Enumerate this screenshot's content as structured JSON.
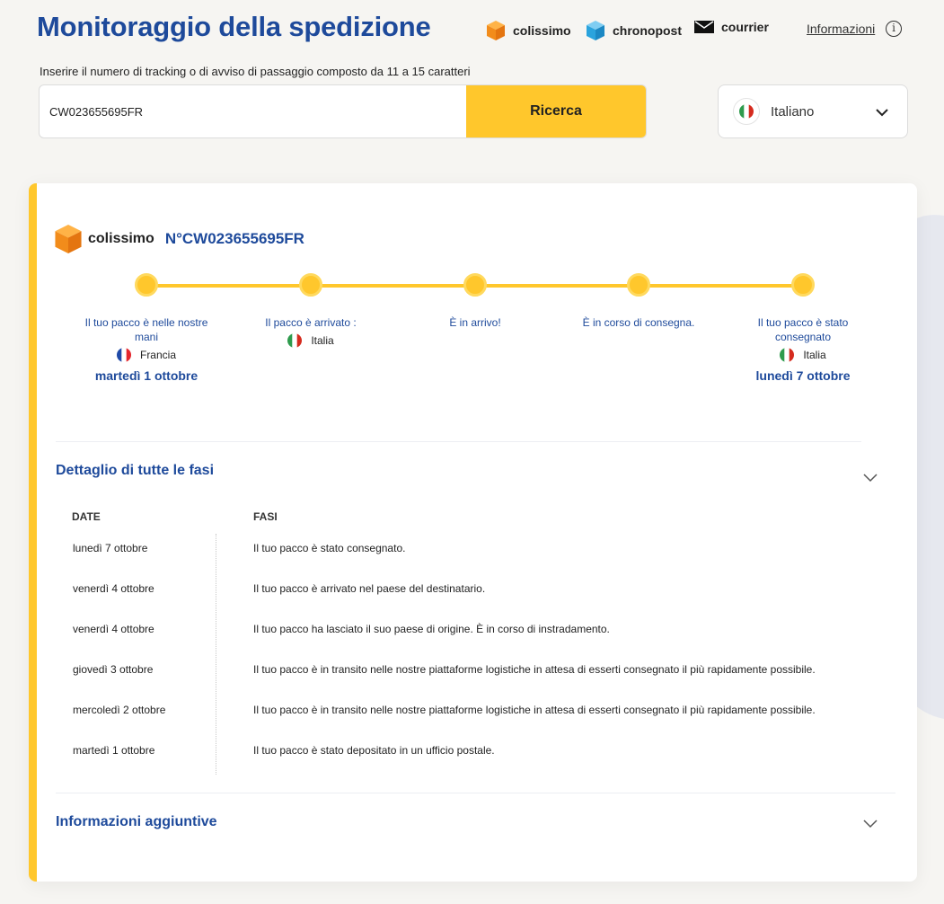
{
  "header": {
    "title": "Monitoraggio della spedizione",
    "brands": [
      "colissimo",
      "chronopost",
      "courrier"
    ],
    "info_link": "Informazioni",
    "info_icon": "i"
  },
  "search": {
    "hint": "Inserire il numero di tracking o di avviso di passaggio composto da 11 a 15 caratteri",
    "value": "CW023655695FR",
    "button": "Ricerca"
  },
  "language": {
    "label": "Italiano",
    "flag": "italy-flag-icon"
  },
  "card": {
    "brand": "colissimo",
    "tracking": "N°CW023655695FR",
    "steps": [
      {
        "label": "Il tuo pacco è nelle nostre mani",
        "country": "Francia",
        "date": "martedì 1 ottobre"
      },
      {
        "label": "Il pacco è arrivato :",
        "country": "Italia",
        "date": ""
      },
      {
        "label": "È in arrivo!",
        "country": "",
        "date": ""
      },
      {
        "label": "È in corso di consegna.",
        "country": "",
        "date": ""
      },
      {
        "label": "Il tuo pacco è stato consegnato",
        "country": "Italia",
        "date": "lunedì 7 ottobre"
      }
    ],
    "details_title": "Dettaglio di tutte le fasi",
    "table": {
      "col_date": "DATE",
      "col_phase": "FASI",
      "rows": [
        {
          "date": "lunedì 7 ottobre",
          "phase": "Il tuo pacco è stato consegnato."
        },
        {
          "date": "venerdì 4 ottobre",
          "phase": "Il tuo pacco è arrivato nel paese del destinatario."
        },
        {
          "date": "venerdì 4 ottobre",
          "phase": "Il tuo pacco ha lasciato il suo paese di origine. È in corso di instradamento."
        },
        {
          "date": "giovedì 3 ottobre",
          "phase": "Il tuo pacco è in transito nelle nostre piattaforme logistiche in attesa di esserti consegnato il più rapidamente possibile."
        },
        {
          "date": "mercoledì 2 ottobre",
          "phase": "Il tuo pacco è in transito nelle nostre piattaforme logistiche in attesa di esserti consegnato il più rapidamente possibile."
        },
        {
          "date": "martedì 1 ottobre",
          "phase": "Il tuo pacco è stato depositato in un ufficio postale."
        }
      ]
    },
    "extra_title": "Informazioni aggiuntive"
  },
  "colors": {
    "brand_blue": "#1e4a9b",
    "accent_yellow": "#ffc72c",
    "background": "#f6f5f2"
  }
}
